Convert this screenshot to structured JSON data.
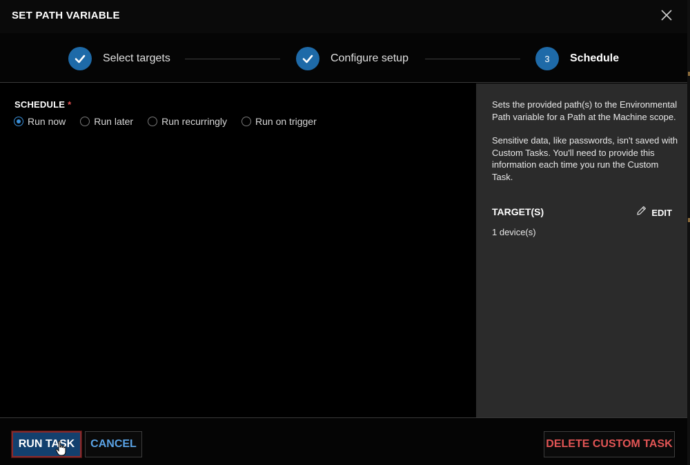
{
  "dialog": {
    "title": "SET PATH VARIABLE"
  },
  "stepper": {
    "steps": [
      {
        "label": "Select targets",
        "state": "done"
      },
      {
        "label": "Configure setup",
        "state": "done"
      },
      {
        "label": "Schedule",
        "number": "3",
        "state": "active"
      }
    ]
  },
  "schedule": {
    "label": "SCHEDULE",
    "required_mark": "*",
    "options": [
      {
        "label": "Run now",
        "checked": true
      },
      {
        "label": "Run later",
        "checked": false
      },
      {
        "label": "Run recurringly",
        "checked": false
      },
      {
        "label": "Run on trigger",
        "checked": false
      }
    ]
  },
  "side_panel": {
    "description": "Sets the provided path(s) to the Environmental Path variable for a Path at the Machine scope.",
    "note": "Sensitive data, like passwords, isn't saved with Custom Tasks. You'll need to provide this information each time you run the Custom Task.",
    "targets_heading": "TARGET(S)",
    "edit_label": "EDIT",
    "targets_value": "1 device(s)"
  },
  "footer": {
    "run_label": "RUN TASK",
    "cancel_label": "CANCEL",
    "delete_label": "DELETE CUSTOM TASK"
  },
  "colors": {
    "accent": "#1e6aa8",
    "link": "#5aa3e6",
    "danger": "#e25555",
    "panel": "#2b2b2b"
  }
}
